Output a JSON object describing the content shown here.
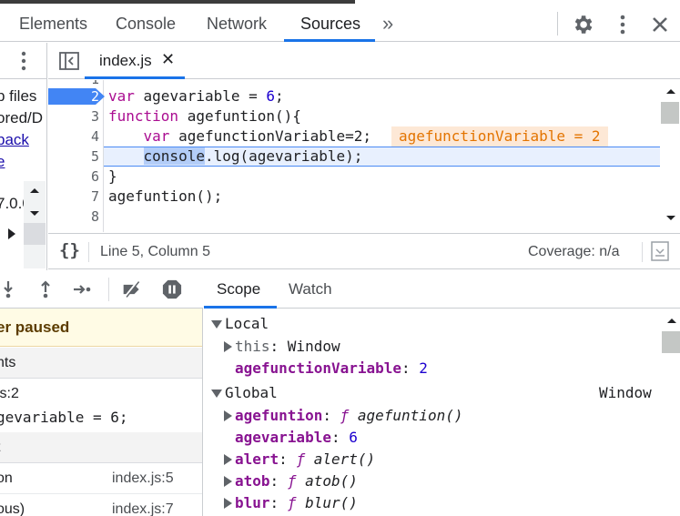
{
  "top_tabs": [
    {
      "label": "Elements",
      "active": false
    },
    {
      "label": "Console",
      "active": false
    },
    {
      "label": "Network",
      "active": false
    },
    {
      "label": "Sources",
      "active": true
    }
  ],
  "more_tabs_glyph": "»",
  "icons": {
    "settings": "gear-icon",
    "menu": "kebab-icon",
    "close": "close-icon"
  },
  "navigator": {
    "line1": "p files",
    "line2": "ored/D",
    "link1": "back",
    "link2": "e",
    "ip_fragment": "7.0.0"
  },
  "editor": {
    "file_tab": "index.js",
    "file_close": "✕",
    "line_numbers": [
      "1",
      "2",
      "3",
      "4",
      "5",
      "6",
      "7",
      "8"
    ],
    "code": {
      "l2_kw": "var",
      "l2_rest": " agevariable = ",
      "l2_num": "6",
      "l2_end": ";",
      "l3_kw": "function",
      "l3_rest": " agefuntion(){",
      "l4_indent": "    ",
      "l4_kw": "var",
      "l4_rest": " agefunctionVariable=2;",
      "l5_indent": "    ",
      "l5_sel": "console",
      "l5_rest": ".log(agevariable);",
      "l6": "}",
      "l7": "agefuntion();"
    },
    "inline_value": "agefunctionVariable = 2",
    "breakpoint_line": "2",
    "current_line": 5
  },
  "statusbar": {
    "braces": "{}",
    "position": "Line 5, Column 5",
    "coverage": "Coverage: n/a"
  },
  "debugger": {
    "paused_text": "er paused",
    "breakpoints_header": "nts",
    "breakpoint_file": "js:2",
    "breakpoint_code": "gevariable = 6;",
    "callstack_header": "t",
    "call_frames": [
      {
        "fn": "on",
        "loc": "index.js:5"
      },
      {
        "fn": "ous)",
        "loc": "index.js:7"
      }
    ]
  },
  "scope_tabs": [
    {
      "label": "Scope",
      "active": true
    },
    {
      "label": "Watch",
      "active": false
    }
  ],
  "scope": {
    "local_label": "Local",
    "this_name": "this",
    "this_value": "Window",
    "local_var_name": "agefunctionVariable",
    "local_var_value": "2",
    "global_label": "Global",
    "global_value": "Window",
    "g_items": [
      {
        "name": "agefuntion",
        "f": "ƒ",
        "sig": "agefuntion()",
        "expandable": true
      },
      {
        "name": "agevariable",
        "num": "6",
        "expandable": false
      },
      {
        "name": "alert",
        "f": "ƒ",
        "sig": "alert()",
        "expandable": true
      },
      {
        "name": "atob",
        "f": "ƒ",
        "sig": "atob()",
        "expandable": true
      },
      {
        "name": "blur",
        "f": "ƒ",
        "sig": "blur()",
        "expandable": true
      }
    ]
  },
  "colors": {
    "accent": "#1a73e8",
    "paused_bg": "#fffbe5",
    "inline_value_bg": "#fde8d6",
    "keyword": "#aa0d91",
    "number": "#1c00cf"
  }
}
